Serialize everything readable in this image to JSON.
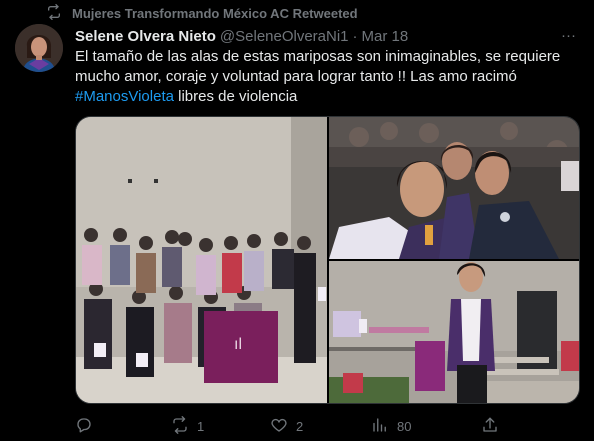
{
  "retweet": {
    "icon": "retweet-icon",
    "label": "Mujeres Transformando México AC Retweeted"
  },
  "tweet": {
    "author_name": "Selene Olvera Nieto",
    "author_handle": "@SeleneOlveraNi1",
    "separator": "·",
    "date": "Mar 18",
    "more_label": "···",
    "text_main": "El tamaño de las alas de estas mariposas son inimaginables, se requiere mucho amor, coraje y voluntad para lograr tanto !! Las amo racimó",
    "hashtag": "#ManosVioleta",
    "text_after": " libres de violencia"
  },
  "media": {
    "photos": [
      {
        "name": "group-photo-with-banner"
      },
      {
        "name": "selfie-photo"
      },
      {
        "name": "woman-speaking-photo"
      }
    ]
  },
  "actions": {
    "reply": {
      "icon": "reply-icon",
      "count": ""
    },
    "retweet": {
      "icon": "retweet-icon",
      "count": "1"
    },
    "like": {
      "icon": "heart-icon",
      "count": "2"
    },
    "views": {
      "icon": "views-icon",
      "count": "80"
    },
    "share": {
      "icon": "share-icon",
      "count": ""
    }
  },
  "colors": {
    "background": "#000000",
    "text": "#e7e9ea",
    "muted": "#71767b",
    "link": "#1d9bf0",
    "banner": "#7a1f5c"
  }
}
